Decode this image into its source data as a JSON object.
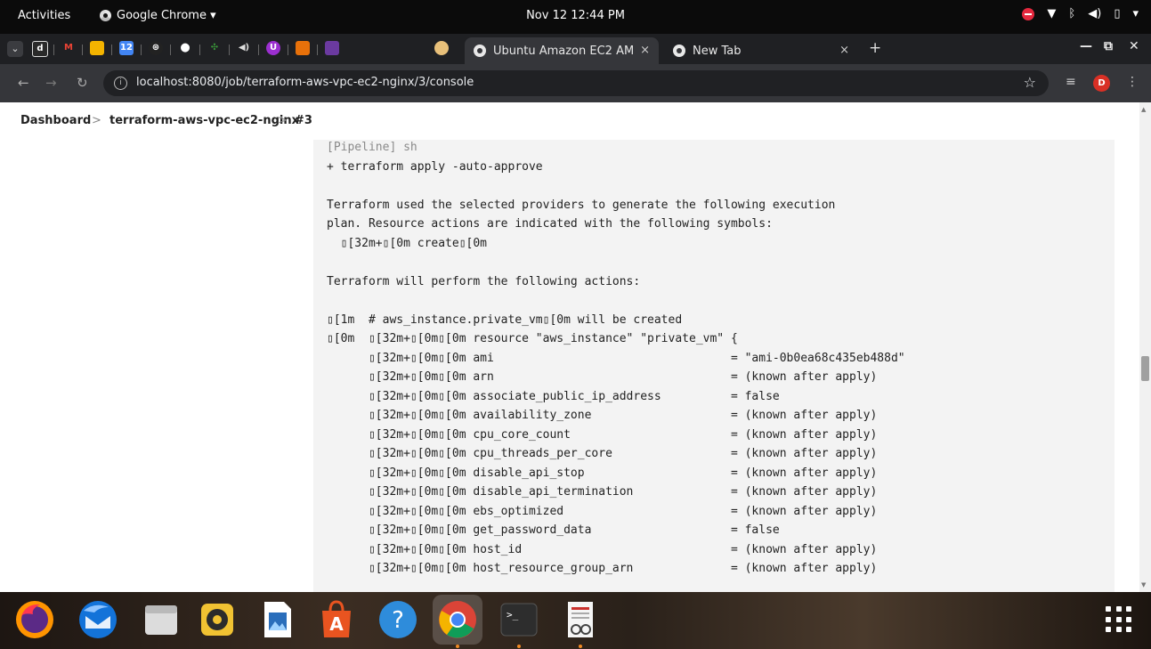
{
  "system_bar": {
    "activities": "Activities",
    "app_name": "Google Chrome ▾",
    "clock": "Nov 12  12:44 PM"
  },
  "tabs": [
    {
      "title": "Ubuntu Amazon EC2 AM",
      "active": true
    },
    {
      "title": "New Tab",
      "active": false
    }
  ],
  "tab_close_symbol": "×",
  "new_tab_symbol": "+",
  "window_controls": {
    "minimize": "—",
    "maximize": "⧉",
    "close": "✕"
  },
  "address": {
    "url": "localhost:8080/job/terraform-aws-vpc-ec2-nginx/3/console",
    "profile_initial": "D"
  },
  "breadcrumb": [
    "Dashboard",
    "terraform-aws-vpc-ec2-nginx",
    "#3"
  ],
  "breadcrumb_separator": ">",
  "console_lines": [
    {
      "text": "[Pipeline] sh",
      "muted": true
    },
    {
      "text": "+ terraform apply -auto-approve",
      "muted": false
    },
    {
      "text": "",
      "muted": false
    },
    {
      "text": "Terraform used the selected providers to generate the following execution",
      "muted": false
    },
    {
      "text": "plan. Resource actions are indicated with the following symbols:",
      "muted": false
    },
    {
      "text": "  ▯[32m+▯[0m create▯[0m",
      "muted": false
    },
    {
      "text": "",
      "muted": false
    },
    {
      "text": "Terraform will perform the following actions:",
      "muted": false
    },
    {
      "text": "",
      "muted": false
    },
    {
      "text": "▯[1m  # aws_instance.private_vm▯[0m will be created",
      "muted": false
    },
    {
      "text": "▯[0m  ▯[32m+▯[0m▯[0m resource \"aws_instance\" \"private_vm\" {",
      "muted": false
    },
    {
      "text": "      ▯[32m+▯[0m▯[0m ami                                  = \"ami-0b0ea68c435eb488d\"",
      "muted": false
    },
    {
      "text": "      ▯[32m+▯[0m▯[0m arn                                  = (known after apply)",
      "muted": false
    },
    {
      "text": "      ▯[32m+▯[0m▯[0m associate_public_ip_address          = false",
      "muted": false
    },
    {
      "text": "      ▯[32m+▯[0m▯[0m availability_zone                    = (known after apply)",
      "muted": false
    },
    {
      "text": "      ▯[32m+▯[0m▯[0m cpu_core_count                       = (known after apply)",
      "muted": false
    },
    {
      "text": "      ▯[32m+▯[0m▯[0m cpu_threads_per_core                 = (known after apply)",
      "muted": false
    },
    {
      "text": "      ▯[32m+▯[0m▯[0m disable_api_stop                     = (known after apply)",
      "muted": false
    },
    {
      "text": "      ▯[32m+▯[0m▯[0m disable_api_termination              = (known after apply)",
      "muted": false
    },
    {
      "text": "      ▯[32m+▯[0m▯[0m ebs_optimized                        = (known after apply)",
      "muted": false
    },
    {
      "text": "      ▯[32m+▯[0m▯[0m get_password_data                    = false",
      "muted": false
    },
    {
      "text": "      ▯[32m+▯[0m▯[0m host_id                              = (known after apply)",
      "muted": false
    },
    {
      "text": "      ▯[32m+▯[0m▯[0m host_resource_group_arn              = (known after apply)",
      "muted": false
    }
  ],
  "dock": [
    {
      "name": "firefox",
      "running": false
    },
    {
      "name": "thunderbird",
      "running": false
    },
    {
      "name": "files",
      "running": false
    },
    {
      "name": "rhythmbox",
      "running": false
    },
    {
      "name": "libreoffice-writer",
      "running": false
    },
    {
      "name": "software-center",
      "running": false
    },
    {
      "name": "help",
      "running": false
    },
    {
      "name": "chrome",
      "running": true
    },
    {
      "name": "terminal",
      "running": true
    },
    {
      "name": "document-viewer",
      "running": true
    }
  ],
  "terminal_prompt_glyph": ">_",
  "help_glyph": "?"
}
